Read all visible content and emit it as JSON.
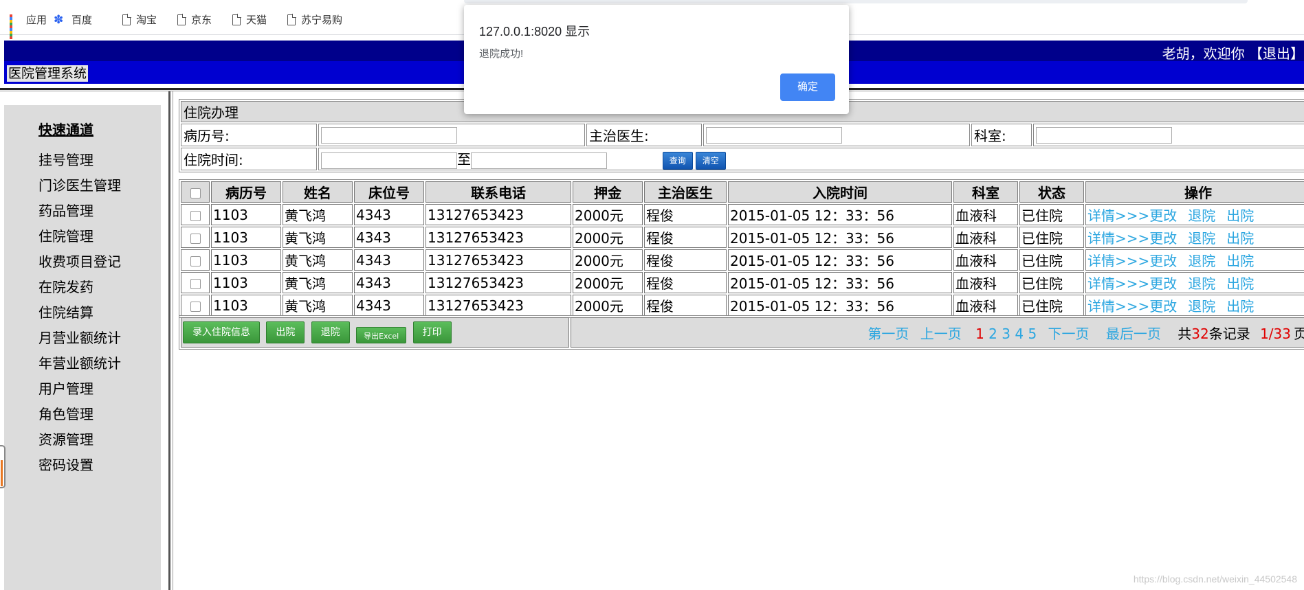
{
  "bookmarks": [
    {
      "label": "应用",
      "icon": "apps-grid-icon"
    },
    {
      "label": "百度",
      "icon": "baidu-paw-icon"
    },
    {
      "label": "淘宝",
      "icon": "page-icon"
    },
    {
      "label": "京东",
      "icon": "page-icon"
    },
    {
      "label": "天猫",
      "icon": "page-icon"
    },
    {
      "label": "苏宁易购",
      "icon": "page-icon"
    }
  ],
  "header": {
    "welcome": "老胡，欢迎你 【退出】",
    "system_title": "医院管理系统",
    "top_color": "#00008b",
    "bottom_color": "#0000d0"
  },
  "sidebar": {
    "quick_label": "快速通道",
    "items": [
      "挂号管理",
      "门诊医生管理",
      "药品管理",
      "住院管理",
      "收费项目登记",
      "在院发药",
      "住院结算",
      "月营业额统计",
      "年营业额统计",
      "用户管理",
      "角色管理",
      "资源管理",
      "密码设置"
    ]
  },
  "search": {
    "caption": "住院办理",
    "record_no_label": "病历号:",
    "doctor_label": "主治医生:",
    "dept_label": "科室:",
    "time_label": "住院时间:",
    "to_label": "至",
    "query_btn": "查询",
    "clear_btn": "清空"
  },
  "table": {
    "headers": [
      "病历号",
      "姓名",
      "床位号",
      "联系电话",
      "押金",
      "主治医生",
      "入院时间",
      "科室",
      "状态",
      "操作"
    ],
    "rows": [
      [
        "1103",
        "黄飞鸿",
        "4343",
        "13127653423",
        "2000元",
        "程俊",
        "2015-01-05 12：33：56",
        "血液科",
        "已住院"
      ],
      [
        "1103",
        "黄飞鸿",
        "4343",
        "13127653423",
        "2000元",
        "程俊",
        "2015-01-05 12：33：56",
        "血液科",
        "已住院"
      ],
      [
        "1103",
        "黄飞鸿",
        "4343",
        "13127653423",
        "2000元",
        "程俊",
        "2015-01-05 12：33：56",
        "血液科",
        "已住院"
      ],
      [
        "1103",
        "黄飞鸿",
        "4343",
        "13127653423",
        "2000元",
        "程俊",
        "2015-01-05 12：33：56",
        "血液科",
        "已住院"
      ],
      [
        "1103",
        "黄飞鸿",
        "4343",
        "13127653423",
        "2000元",
        "程俊",
        "2015-01-05 12：33：56",
        "血液科",
        "已住院"
      ]
    ],
    "ops": {
      "detail": "详情>>>更改",
      "discharge": "退院",
      "leave": "出院"
    },
    "link_color": "#2ba6e0"
  },
  "footer": {
    "buttons": [
      "录入住院信息",
      "出院",
      "退院",
      "导出Excel",
      "打印"
    ],
    "pager": {
      "first": "第一页",
      "prev": "上一页",
      "pages": [
        "1",
        "2",
        "3",
        "4",
        "5"
      ],
      "current": "1",
      "next": "下一页",
      "last": "最后一页",
      "total_prefix": "共",
      "total": "32",
      "total_suffix": "条记录",
      "page_of": "1/33",
      "page_suffix": "页"
    }
  },
  "dialog": {
    "title": "127.0.0.1:8020 显示",
    "message": "退院成功!",
    "ok_label": "确定",
    "ok_color": "#4285f4"
  },
  "watermark": "https://blog.csdn.net/weixin_44502548"
}
